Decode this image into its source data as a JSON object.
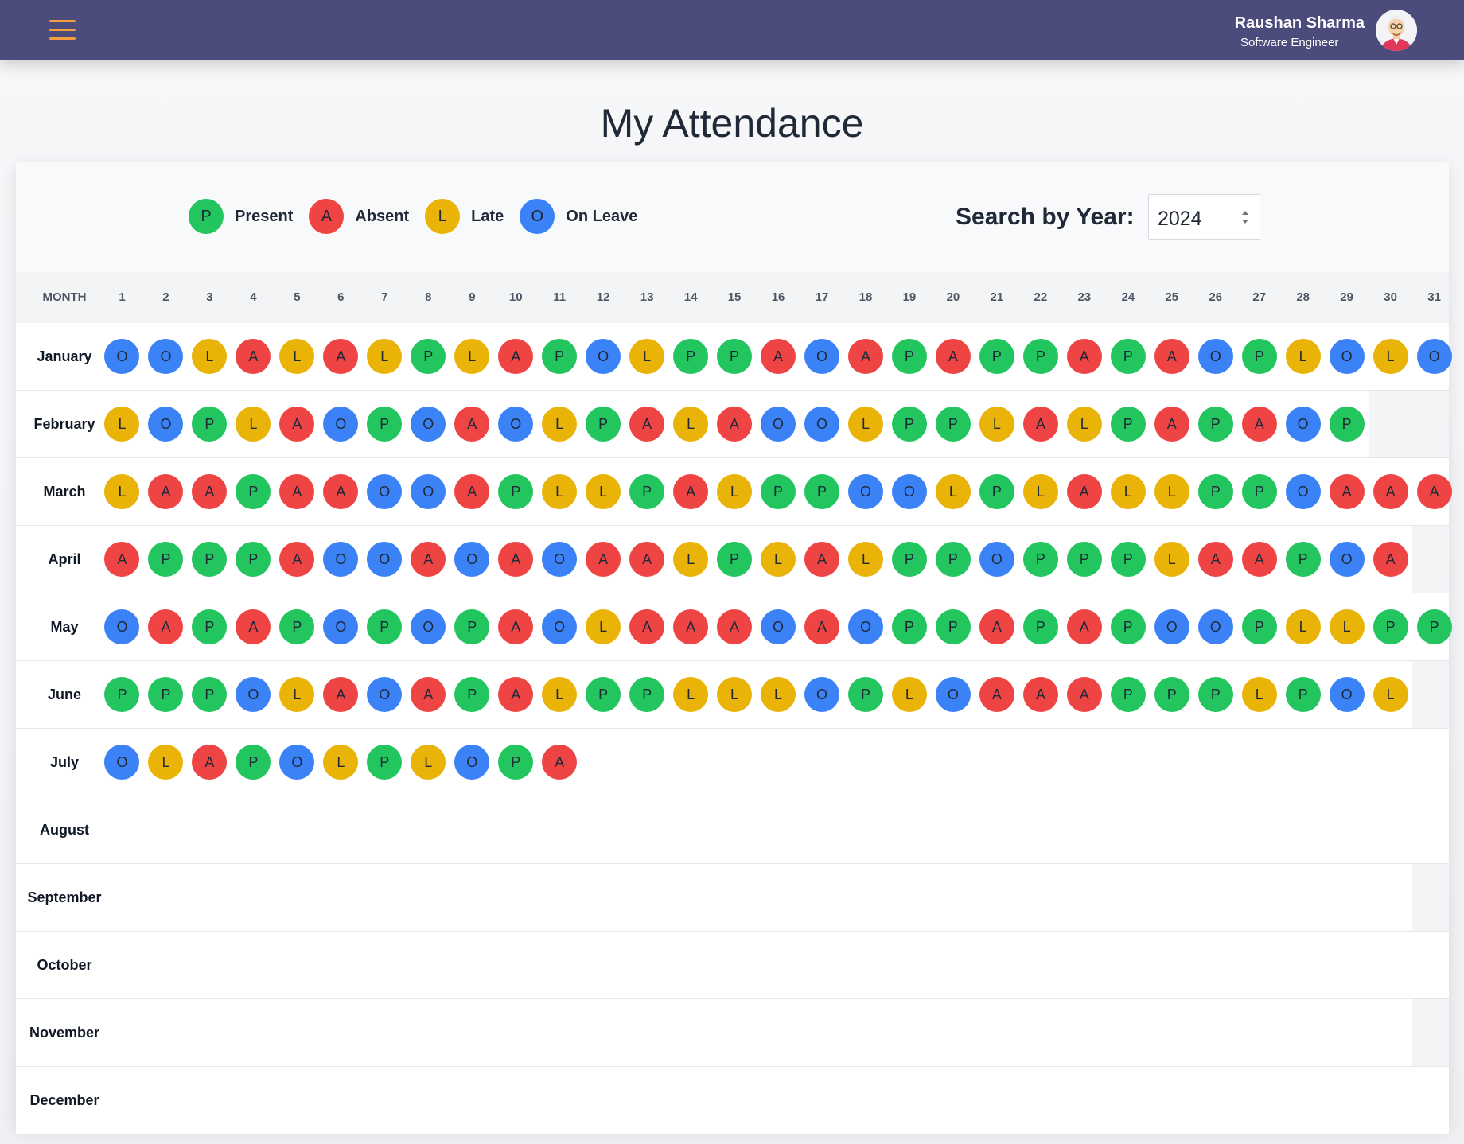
{
  "header": {
    "user_name": "Raushan Sharma",
    "user_role": "Software Engineer"
  },
  "page_title": "My Attendance",
  "legend": [
    {
      "code": "P",
      "label": "Present",
      "color": "#22c55e"
    },
    {
      "code": "A",
      "label": "Absent",
      "color": "#ef4444"
    },
    {
      "code": "L",
      "label": "Late",
      "color": "#eab308"
    },
    {
      "code": "O",
      "label": "On Leave",
      "color": "#3b82f6"
    }
  ],
  "search": {
    "label": "Search by Year:",
    "value": "2024"
  },
  "table": {
    "month_header": "MONTH",
    "days": [
      "1",
      "2",
      "3",
      "4",
      "5",
      "6",
      "7",
      "8",
      "9",
      "10",
      "11",
      "12",
      "13",
      "14",
      "15",
      "16",
      "17",
      "18",
      "19",
      "20",
      "21",
      "22",
      "23",
      "24",
      "25",
      "26",
      "27",
      "28",
      "29",
      "30",
      "31"
    ],
    "rows": [
      {
        "month": "January",
        "days_in_month": 31,
        "codes": [
          "O",
          "O",
          "L",
          "A",
          "L",
          "A",
          "L",
          "P",
          "L",
          "A",
          "P",
          "O",
          "L",
          "P",
          "P",
          "A",
          "O",
          "A",
          "P",
          "A",
          "P",
          "P",
          "A",
          "P",
          "A",
          "O",
          "P",
          "L",
          "O",
          "L",
          "O"
        ]
      },
      {
        "month": "February",
        "days_in_month": 29,
        "codes": [
          "L",
          "O",
          "P",
          "L",
          "A",
          "O",
          "P",
          "O",
          "A",
          "O",
          "L",
          "P",
          "A",
          "L",
          "A",
          "O",
          "O",
          "L",
          "P",
          "P",
          "L",
          "A",
          "L",
          "P",
          "A",
          "P",
          "A",
          "O",
          "P"
        ]
      },
      {
        "month": "March",
        "days_in_month": 31,
        "codes": [
          "L",
          "A",
          "A",
          "P",
          "A",
          "A",
          "O",
          "O",
          "A",
          "P",
          "L",
          "L",
          "P",
          "A",
          "L",
          "P",
          "P",
          "O",
          "O",
          "L",
          "P",
          "L",
          "A",
          "L",
          "L",
          "P",
          "P",
          "O",
          "A",
          "A",
          "A"
        ]
      },
      {
        "month": "April",
        "days_in_month": 30,
        "codes": [
          "A",
          "P",
          "P",
          "P",
          "A",
          "O",
          "O",
          "A",
          "O",
          "A",
          "O",
          "A",
          "A",
          "L",
          "P",
          "L",
          "A",
          "L",
          "P",
          "P",
          "O",
          "P",
          "P",
          "P",
          "L",
          "A",
          "A",
          "P",
          "O",
          "A"
        ]
      },
      {
        "month": "May",
        "days_in_month": 31,
        "codes": [
          "O",
          "A",
          "P",
          "A",
          "P",
          "O",
          "P",
          "O",
          "P",
          "A",
          "O",
          "L",
          "A",
          "A",
          "A",
          "O",
          "A",
          "O",
          "P",
          "P",
          "A",
          "P",
          "A",
          "P",
          "O",
          "O",
          "P",
          "L",
          "L",
          "P",
          "P"
        ]
      },
      {
        "month": "June",
        "days_in_month": 30,
        "codes": [
          "P",
          "P",
          "P",
          "O",
          "L",
          "A",
          "O",
          "A",
          "P",
          "A",
          "L",
          "P",
          "P",
          "L",
          "L",
          "L",
          "O",
          "P",
          "L",
          "O",
          "A",
          "A",
          "A",
          "P",
          "P",
          "P",
          "L",
          "P",
          "O",
          "L"
        ]
      },
      {
        "month": "July",
        "days_in_month": 31,
        "codes": [
          "O",
          "L",
          "A",
          "P",
          "O",
          "L",
          "P",
          "L",
          "O",
          "P",
          "A"
        ]
      },
      {
        "month": "August",
        "days_in_month": 31,
        "codes": []
      },
      {
        "month": "September",
        "days_in_month": 30,
        "codes": []
      },
      {
        "month": "October",
        "days_in_month": 31,
        "codes": []
      },
      {
        "month": "November",
        "days_in_month": 30,
        "codes": []
      },
      {
        "month": "December",
        "days_in_month": 31,
        "codes": []
      }
    ]
  },
  "icons": {
    "menu": "hamburger-menu-icon",
    "avatar": "user-avatar"
  }
}
